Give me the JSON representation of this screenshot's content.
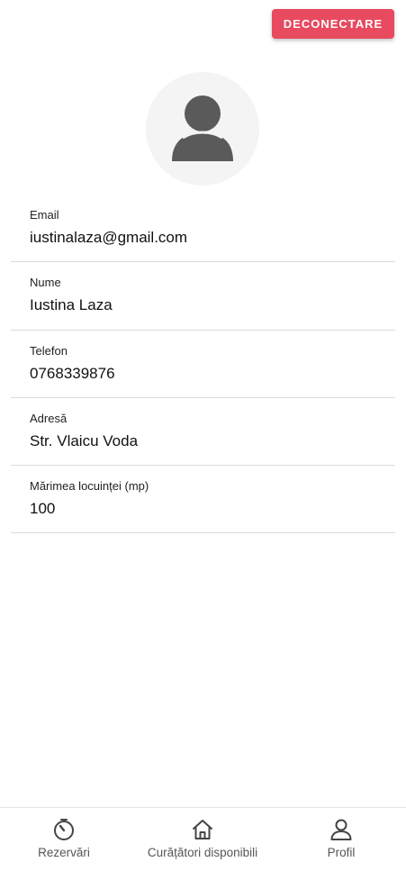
{
  "header": {
    "logout_label": "DECONECTARE"
  },
  "profile": {
    "avatar_icon": "user-avatar-icon",
    "fields": [
      {
        "label": "Email",
        "value": "iustinalaza@gmail.com"
      },
      {
        "label": "Nume",
        "value": "Iustina Laza"
      },
      {
        "label": "Telefon",
        "value": "0768339876"
      },
      {
        "label": "Adresă",
        "value": "Str. Vlaicu Voda"
      },
      {
        "label": "Mărimea locuinței (mp)",
        "value": "100"
      }
    ]
  },
  "bottom_nav": {
    "items": [
      {
        "label": "Rezervări",
        "icon": "timer-icon"
      },
      {
        "label": "Curățători disponibili",
        "icon": "home-icon"
      },
      {
        "label": "Profil",
        "icon": "person-icon"
      }
    ]
  },
  "colors": {
    "accent": "#e84a5f",
    "avatar_bg": "#f4f4f4",
    "avatar_fg": "#5a5a5a",
    "divider": "#dcdcdc"
  }
}
